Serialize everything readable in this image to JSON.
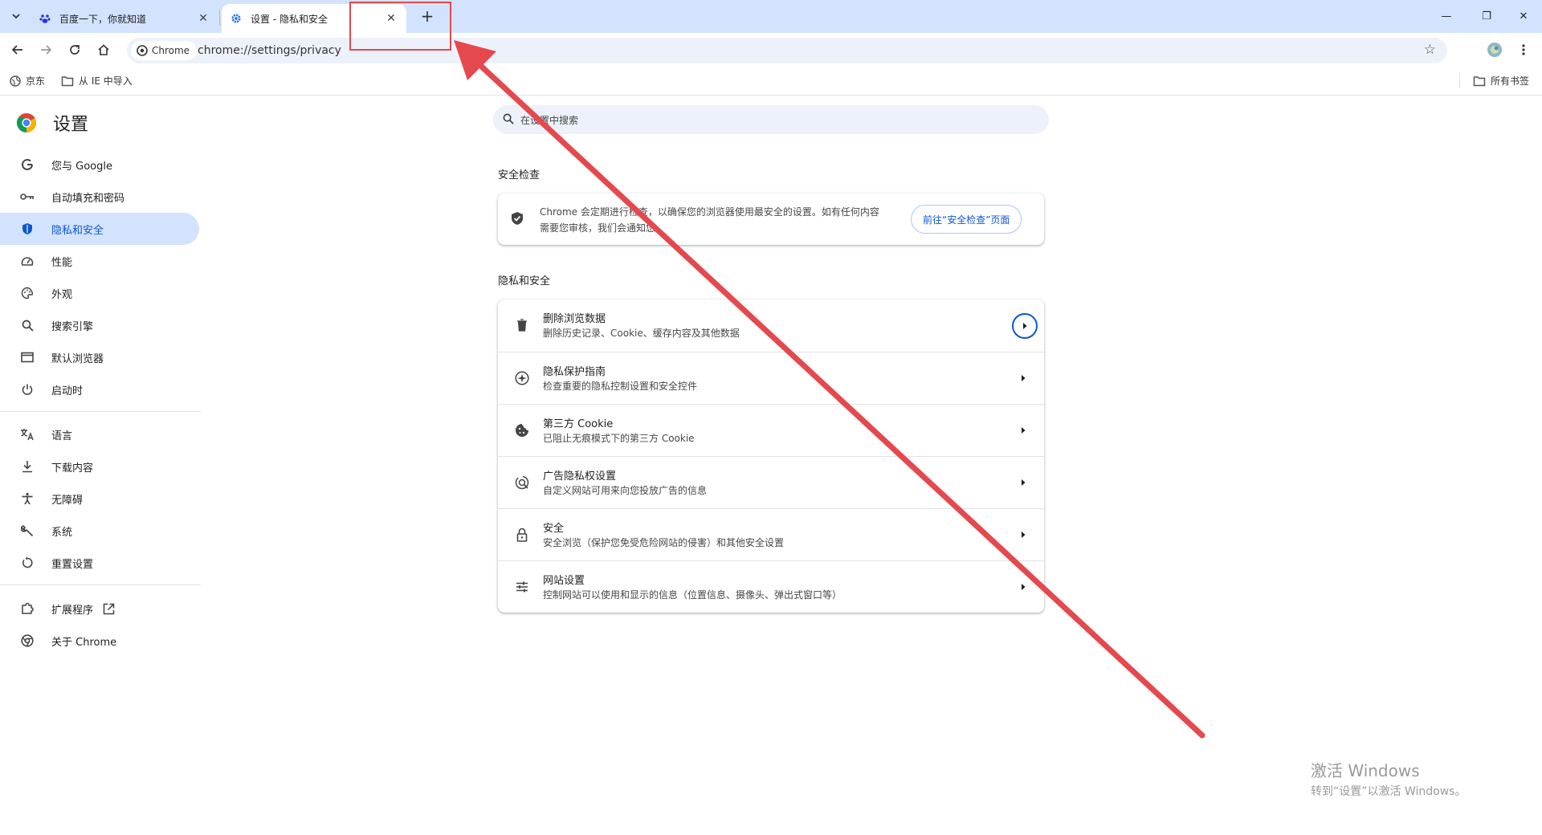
{
  "tabs": [
    {
      "title": "百度一下，你就知道",
      "state": "inactive"
    },
    {
      "title": "设置 - 隐私和安全",
      "state": "active"
    }
  ],
  "window_controls": {
    "minimize": "—",
    "restore": "❐",
    "close": "✕"
  },
  "toolbar": {
    "chip_label": "Chrome",
    "url": "chrome://settings/privacy"
  },
  "bookmarks": {
    "items": [
      "京东",
      "从 IE 中导入"
    ],
    "all_bookmarks": "所有书签"
  },
  "sidebar": {
    "title": "设置",
    "items": [
      {
        "label": "您与 Google",
        "icon": "google-icon"
      },
      {
        "label": "自动填充和密码",
        "icon": "key-icon"
      },
      {
        "label": "隐私和安全",
        "icon": "shield-icon",
        "selected": true
      },
      {
        "label": "性能",
        "icon": "speedometer-icon"
      },
      {
        "label": "外观",
        "icon": "palette-icon"
      },
      {
        "label": "搜索引擎",
        "icon": "search-icon"
      },
      {
        "label": "默认浏览器",
        "icon": "browser-icon"
      },
      {
        "label": "启动时",
        "icon": "power-icon"
      },
      {
        "label": "语言",
        "icon": "translate-icon"
      },
      {
        "label": "下载内容",
        "icon": "download-icon"
      },
      {
        "label": "无障碍",
        "icon": "accessibility-icon"
      },
      {
        "label": "系统",
        "icon": "wrench-icon"
      },
      {
        "label": "重置设置",
        "icon": "reset-icon"
      },
      {
        "label": "扩展程序",
        "icon": "puzzle-icon"
      },
      {
        "label": "关于 Chrome",
        "icon": "chrome-icon"
      }
    ]
  },
  "main": {
    "search_placeholder": "在设置中搜索",
    "safety_check": {
      "section_title": "安全检查",
      "text": "Chrome 会定期进行检查，以确保您的浏览器使用最安全的设置。如有任何内容需要您审核，我们会通知您。",
      "button": "前往“安全检查”页面"
    },
    "privacy": {
      "section_title": "隐私和安全",
      "rows": [
        {
          "title": "删除浏览数据",
          "subtitle": "删除历史记录、Cookie、缓存内容及其他数据",
          "icon": "trash-icon"
        },
        {
          "title": "隐私保护指南",
          "subtitle": "检查重要的隐私控制设置和安全控件",
          "icon": "compass-icon"
        },
        {
          "title": "第三方 Cookie",
          "subtitle": "已阻止无痕模式下的第三方 Cookie",
          "icon": "cookie-icon"
        },
        {
          "title": "广告隐私权设置",
          "subtitle": "自定义网站可用来向您投放广告的信息",
          "icon": "ad-privacy-icon"
        },
        {
          "title": "安全",
          "subtitle": "安全浏览（保护您免受危险网站的侵害）和其他安全设置",
          "icon": "lock-icon"
        },
        {
          "title": "网站设置",
          "subtitle": "控制网站可以使用和显示的信息（位置信息、摄像头、弹出式窗口等）",
          "icon": "sliders-icon"
        }
      ]
    }
  },
  "watermark": {
    "line1": "激活 Windows",
    "line2": "转到“设置”以激活 Windows。"
  },
  "colors": {
    "tabstrip": "#d3e3fd",
    "accent": "#0b57d0",
    "annotation": "#e5484d"
  }
}
